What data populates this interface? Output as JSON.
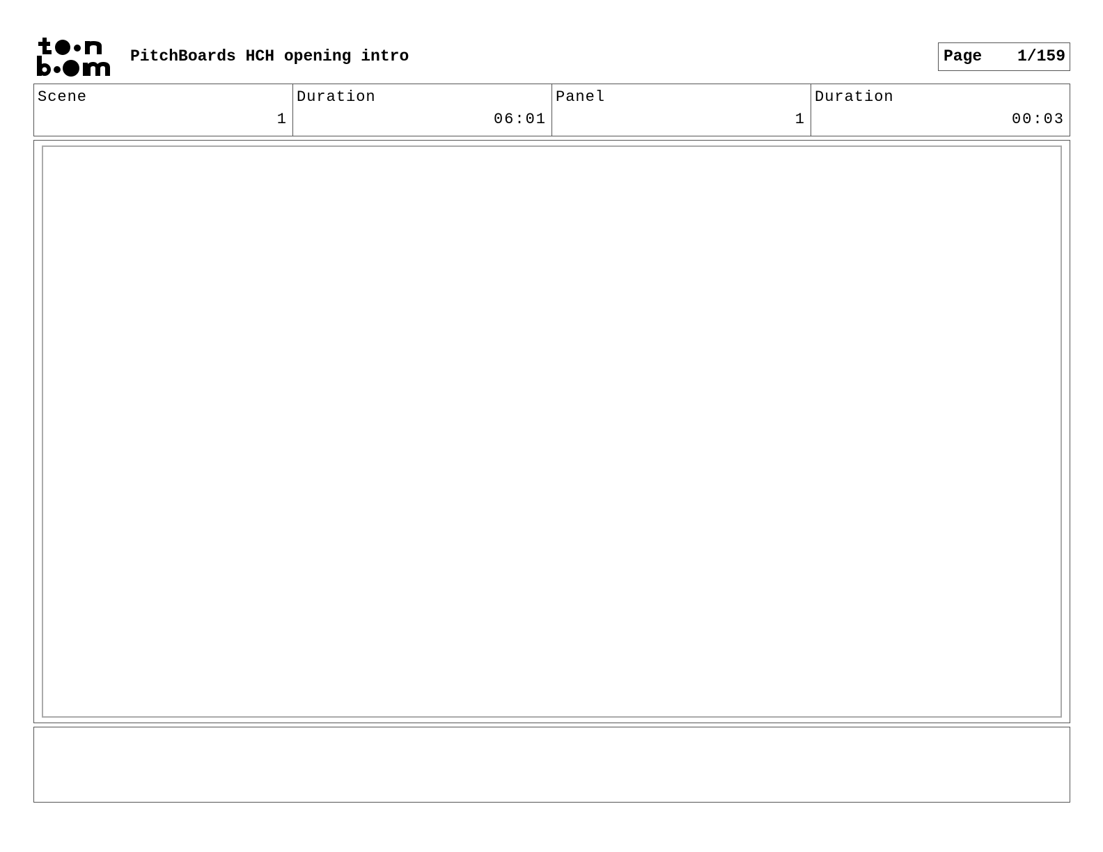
{
  "header": {
    "logo_text": "toon boom",
    "title": "PitchBoards HCH opening intro",
    "page_label": "Page",
    "page_number": "1/159"
  },
  "info": [
    {
      "label": "Scene",
      "value": "1"
    },
    {
      "label": "Duration",
      "value": "06:01"
    },
    {
      "label": "Panel",
      "value": "1"
    },
    {
      "label": "Duration",
      "value": "00:03"
    }
  ],
  "colors": {
    "border": "#555555",
    "panel_inner_border": "#aaaaaa",
    "logo": "#000000"
  },
  "icons": [
    "toon-boom-logo"
  ]
}
